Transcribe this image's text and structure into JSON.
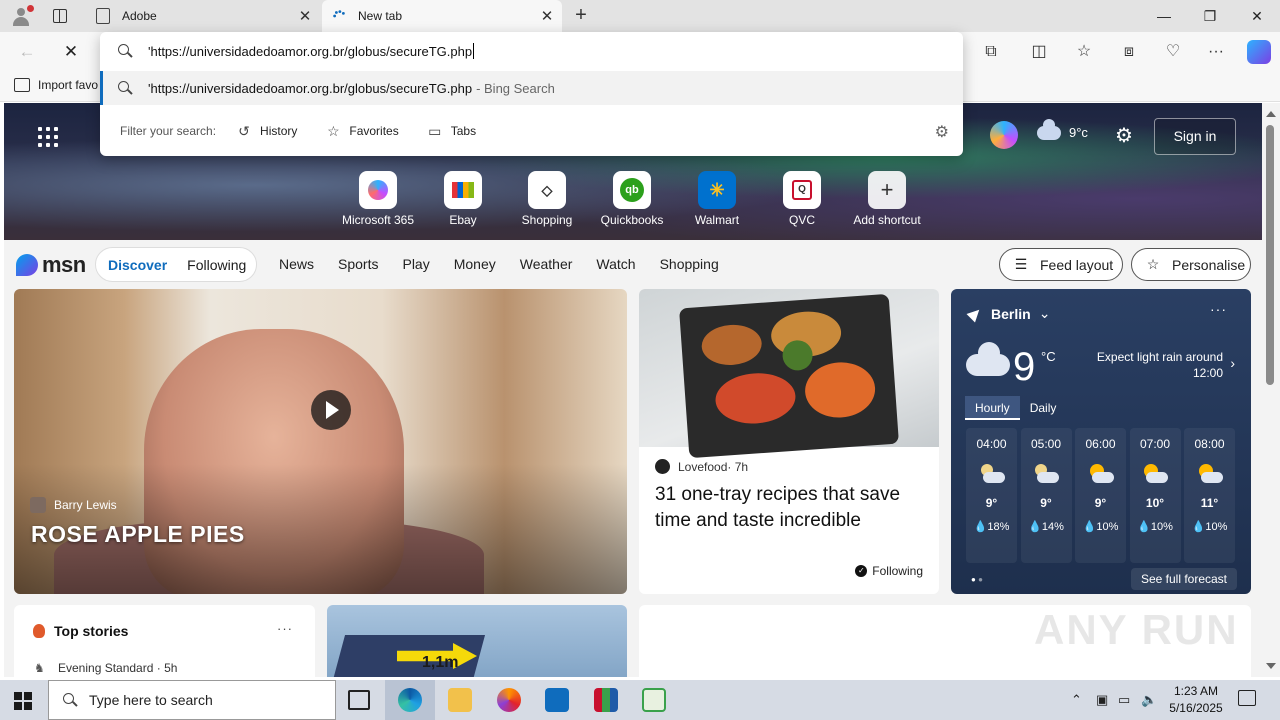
{
  "browser": {
    "tabs": [
      {
        "title": "Adobe",
        "close": "✕"
      },
      {
        "title": "New tab",
        "close": "✕"
      }
    ],
    "new_tab": "+",
    "window_controls": {
      "minimize": "—",
      "maximize": "❐",
      "close": "✕"
    },
    "favorites_bar": {
      "import_label": "Import favo"
    }
  },
  "omnibox": {
    "typed_text": "'https://universidadedoamor.org.br/globus/secureTG.php",
    "suggestion_text": "'https://universidadedoamor.org.br/globus/secureTG.php",
    "suggestion_source": " - Bing Search",
    "filter_label": "Filter your search:",
    "filters": [
      {
        "label": "History",
        "icon": "history-icon"
      },
      {
        "label": "Favorites",
        "icon": "star-icon"
      },
      {
        "label": "Tabs",
        "icon": "tabs-icon"
      }
    ]
  },
  "newtab": {
    "hero_weather_temp": "9°c",
    "signin_label": "Sign in",
    "shortcuts": [
      {
        "label": "Microsoft 365"
      },
      {
        "label": "Ebay"
      },
      {
        "label": "Shopping"
      },
      {
        "label": "Quickbooks"
      },
      {
        "label": "Walmart"
      },
      {
        "label": "QVC"
      },
      {
        "label": "Add shortcut"
      }
    ],
    "msn_logo": "msn",
    "segment": {
      "discover": "Discover",
      "following": "Following"
    },
    "nav_links": [
      "News",
      "Sports",
      "Play",
      "Money",
      "Weather",
      "Watch",
      "Shopping"
    ],
    "feed_layout": "Feed layout",
    "personalise": "Personalise"
  },
  "cards": {
    "video": {
      "author": "Barry Lewis",
      "title": "ROSE APPLE PIES"
    },
    "food": {
      "source": "Lovefood",
      "age": " · 7h",
      "title": "31 one-tray recipes that save time and taste incredible",
      "following": "Following"
    },
    "weather": {
      "city": "Berlin",
      "chevron": "⌄",
      "more": "···",
      "temp": "9",
      "unit": "°C",
      "description": "Expect light rain around 12:00",
      "tabs": [
        "Hourly",
        "Daily"
      ],
      "hours": [
        {
          "time": "04:00",
          "temp": "9°",
          "precip": "18%"
        },
        {
          "time": "05:00",
          "temp": "9°",
          "precip": "14%"
        },
        {
          "time": "06:00",
          "temp": "9°",
          "precip": "10%"
        },
        {
          "time": "07:00",
          "temp": "10°",
          "precip": "10%"
        },
        {
          "time": "08:00",
          "temp": "11°",
          "precip": "10%"
        }
      ],
      "see_full": "See full forecast"
    },
    "top_stories": {
      "title": "Top stories",
      "more": "···",
      "source": "Evening Standard · 5h"
    },
    "solar": {
      "badge": "1,1m"
    }
  },
  "watermark": "ANY RUN",
  "taskbar": {
    "search_placeholder": "Type here to search",
    "time": "1:23 AM",
    "date": "5/16/2025"
  }
}
